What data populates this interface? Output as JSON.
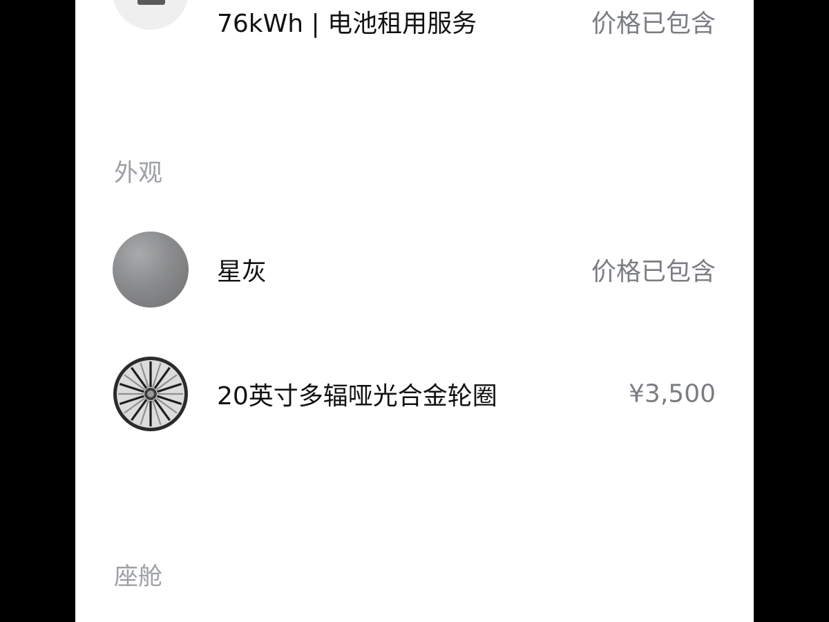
{
  "colors": {
    "page_background": "#ffffff",
    "outer_background": "#000000",
    "primary_text": "#111111",
    "secondary_text": "#7a7d82",
    "section_title_text": "#9da0a5",
    "star_grey_swatch": "#8a8b8c"
  },
  "top_item": {
    "name": "76kWh | 电池租用服务",
    "price": "价格已包含",
    "icon": "battery-thumbnail-icon"
  },
  "exterior": {
    "title": "外观",
    "items": [
      {
        "name": "星灰",
        "price": "价格已包含",
        "icon": "color-swatch-icon"
      },
      {
        "name": "20英寸多辐哑光合金轮圈",
        "price": "¥3,500",
        "icon": "alloy-wheel-icon"
      }
    ]
  },
  "cabin": {
    "title": "座舱"
  }
}
